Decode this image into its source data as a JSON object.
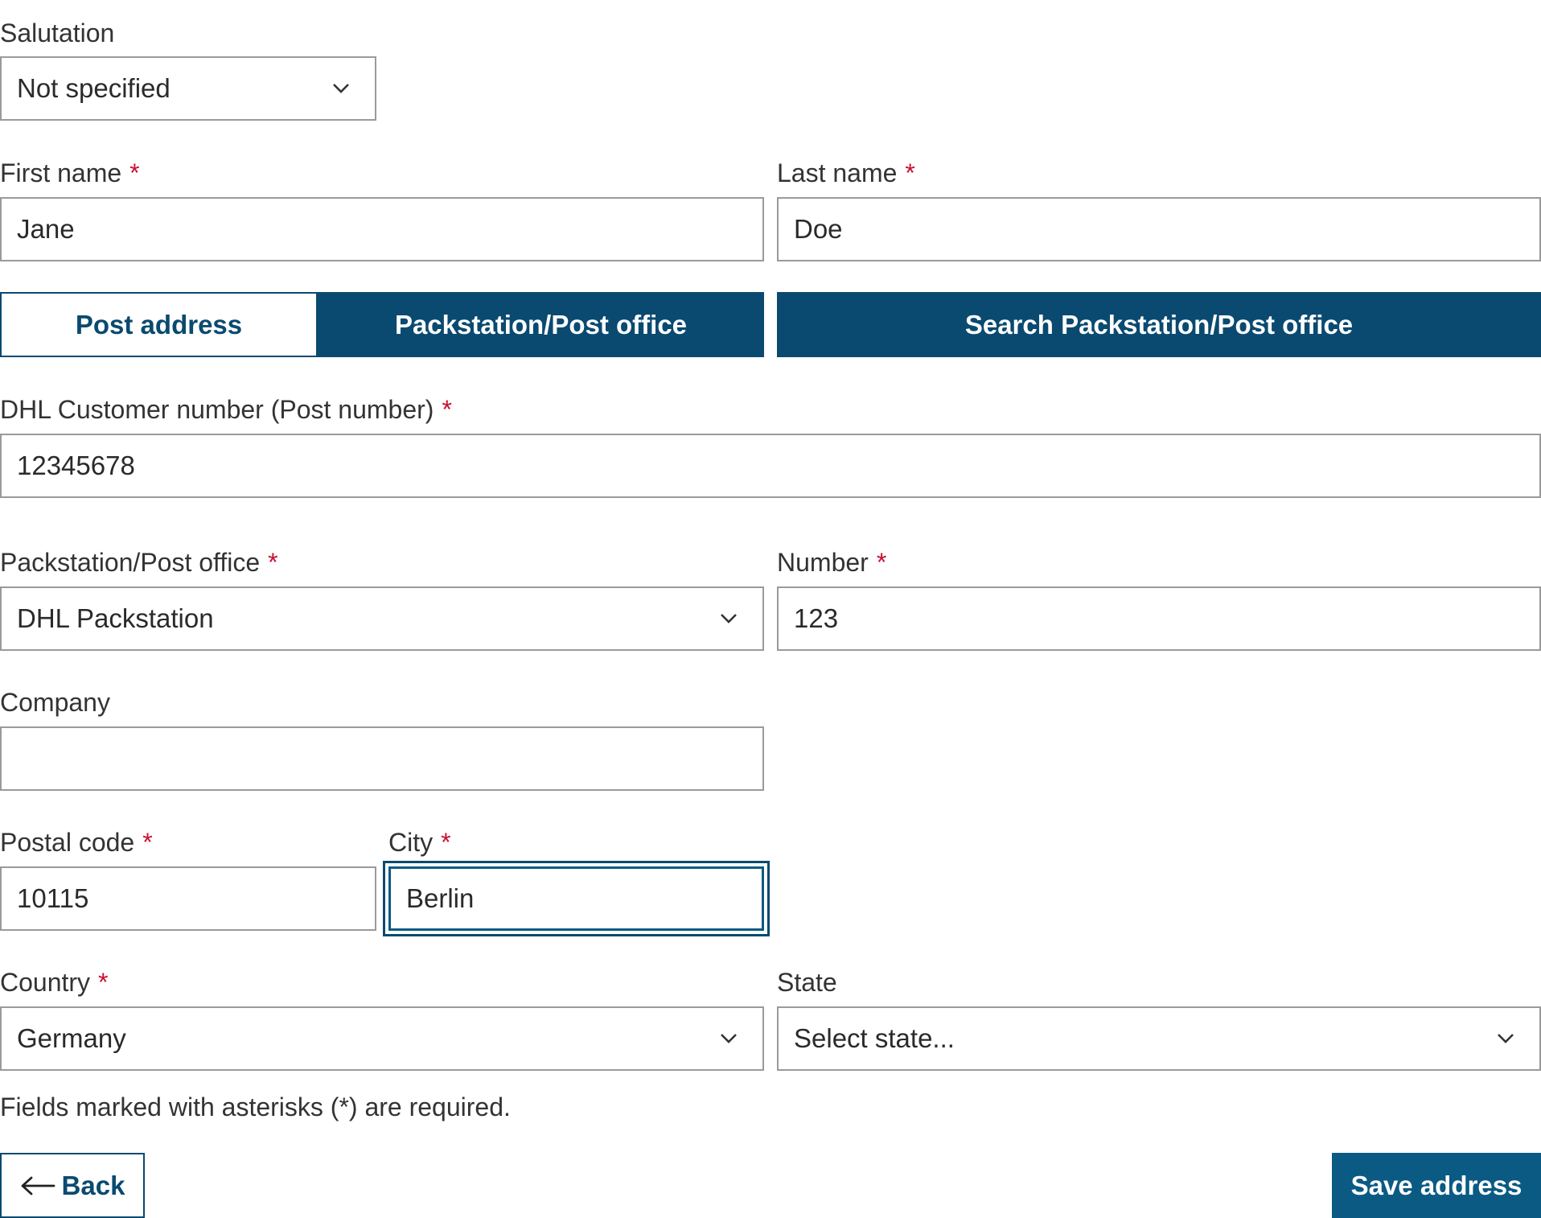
{
  "form": {
    "salutation": {
      "label": "Salutation",
      "value": "Not specified"
    },
    "first_name": {
      "label": "First name",
      "required": "*",
      "value": "Jane"
    },
    "last_name": {
      "label": "Last name",
      "required": "*",
      "value": "Doe"
    },
    "address_type_tabs": {
      "post_address": "Post address",
      "packstation": "Packstation/Post office"
    },
    "search_button": "Search Packstation/Post office",
    "customer_number": {
      "label": "DHL Customer number (Post number)",
      "required": "*",
      "value": "12345678"
    },
    "packstation_type": {
      "label": "Packstation/Post office",
      "required": "*",
      "value": "DHL Packstation"
    },
    "number": {
      "label": "Number",
      "required": "*",
      "value": "123"
    },
    "company": {
      "label": "Company",
      "value": ""
    },
    "postal_code": {
      "label": "Postal code",
      "required": "*",
      "value": "10115"
    },
    "city": {
      "label": "City",
      "required": "*",
      "value": "Berlin"
    },
    "country": {
      "label": "Country",
      "required": "*",
      "value": "Germany"
    },
    "state": {
      "label": "State",
      "value": "Select state..."
    },
    "required_note": "Fields marked with asterisks (*) are required.",
    "back_button": "Back",
    "save_button": "Save address"
  },
  "icons": {
    "dropdown": "chevron-down-icon",
    "back": "arrow-left-icon"
  },
  "colors": {
    "primary": "#0a4a70",
    "save_button": "#0a5a84",
    "required_asterisk": "#c8102e",
    "field_border": "#9a9a9a"
  }
}
